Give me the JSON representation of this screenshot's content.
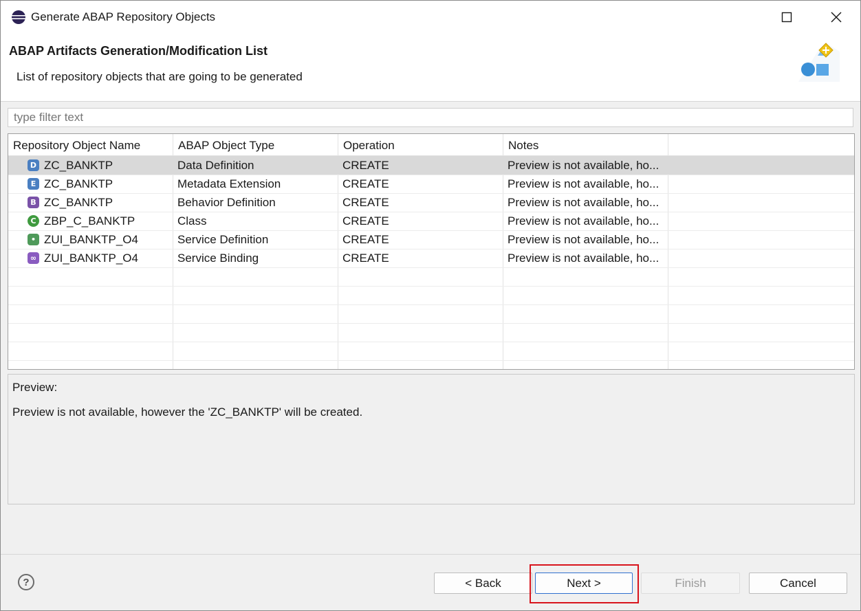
{
  "window": {
    "title": "Generate ABAP Repository Objects"
  },
  "banner": {
    "title": "ABAP Artifacts Generation/Modification List",
    "description": "List of repository objects that are going to be generated"
  },
  "filter": {
    "placeholder": "type filter text",
    "value": ""
  },
  "table": {
    "columns": [
      "Repository Object Name",
      "ABAP Object Type",
      "Operation",
      "Notes"
    ],
    "rows": [
      {
        "icon": "data-definition-icon",
        "icon_letter": "D",
        "icon_color": "#4a7fc1",
        "name": "ZC_BANKTP",
        "type": "Data Definition",
        "operation": "CREATE",
        "notes": "Preview is not available, ho..."
      },
      {
        "icon": "metadata-extension-icon",
        "icon_letter": "E",
        "icon_color": "#4a7fc1",
        "name": "ZC_BANKTP",
        "type": "Metadata Extension",
        "operation": "CREATE",
        "notes": "Preview is not available, ho..."
      },
      {
        "icon": "behavior-definition-icon",
        "icon_letter": "B",
        "icon_color": "#7a52a8",
        "name": "ZC_BANKTP",
        "type": "Behavior Definition",
        "operation": "CREATE",
        "notes": "Preview is not available, ho..."
      },
      {
        "icon": "class-icon",
        "icon_letter": "C",
        "icon_color": "#3f9a3f",
        "name": "ZBP_C_BANKTP",
        "type": "Class",
        "operation": "CREATE",
        "notes": "Preview is not available, ho..."
      },
      {
        "icon": "service-definition-icon",
        "icon_letter": "•",
        "icon_color": "#4f9a5a",
        "name": "ZUI_BANKTP_O4",
        "type": "Service Definition",
        "operation": "CREATE",
        "notes": "Preview is not available, ho..."
      },
      {
        "icon": "service-binding-icon",
        "icon_letter": "∞",
        "icon_color": "#8a5cc0",
        "name": "ZUI_BANKTP_O4",
        "type": "Service Binding",
        "operation": "CREATE",
        "notes": "Preview is not available, ho..."
      }
    ],
    "selected_row": 0
  },
  "preview": {
    "label": "Preview:",
    "text": "Preview is not available, however the 'ZC_BANKTP' will be created."
  },
  "buttons": {
    "back": "< Back",
    "next": "Next >",
    "finish": "Finish",
    "cancel": "Cancel",
    "help": "?"
  }
}
